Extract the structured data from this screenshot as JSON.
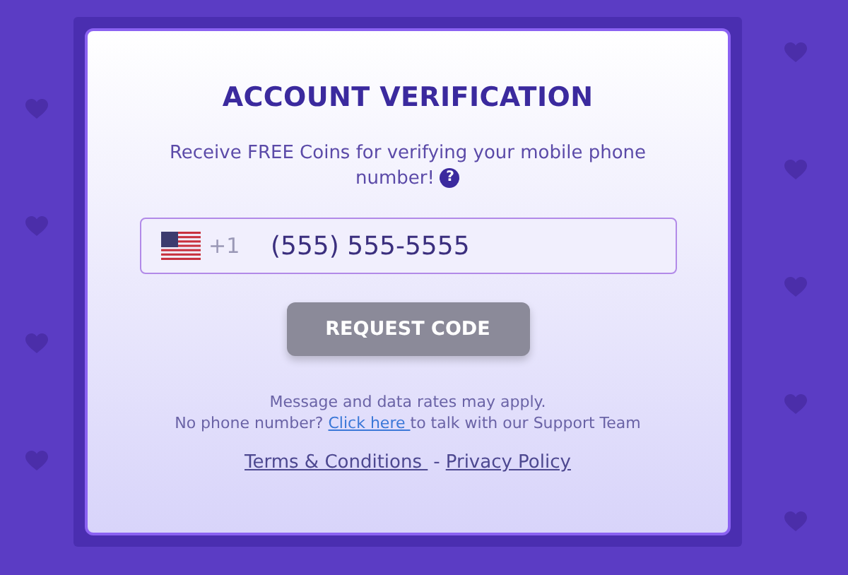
{
  "card": {
    "title": "ACCOUNT VERIFICATION",
    "subtitle": "Receive FREE Coins for verifying your mobile phone number!",
    "help_icon": "?",
    "phone": {
      "dial_code": "+1",
      "placeholder": "(555) 555-5555"
    },
    "button": "REQUEST CODE",
    "notice": "Message and data rates may apply.",
    "support": {
      "before": "No phone number? ",
      "link": "Click here ",
      "after": "to talk with our Support Team"
    },
    "links": [
      {
        "label": "Terms & Conditions "
      },
      {
        "label": "Privacy Policy"
      }
    ],
    "separator": "-"
  }
}
